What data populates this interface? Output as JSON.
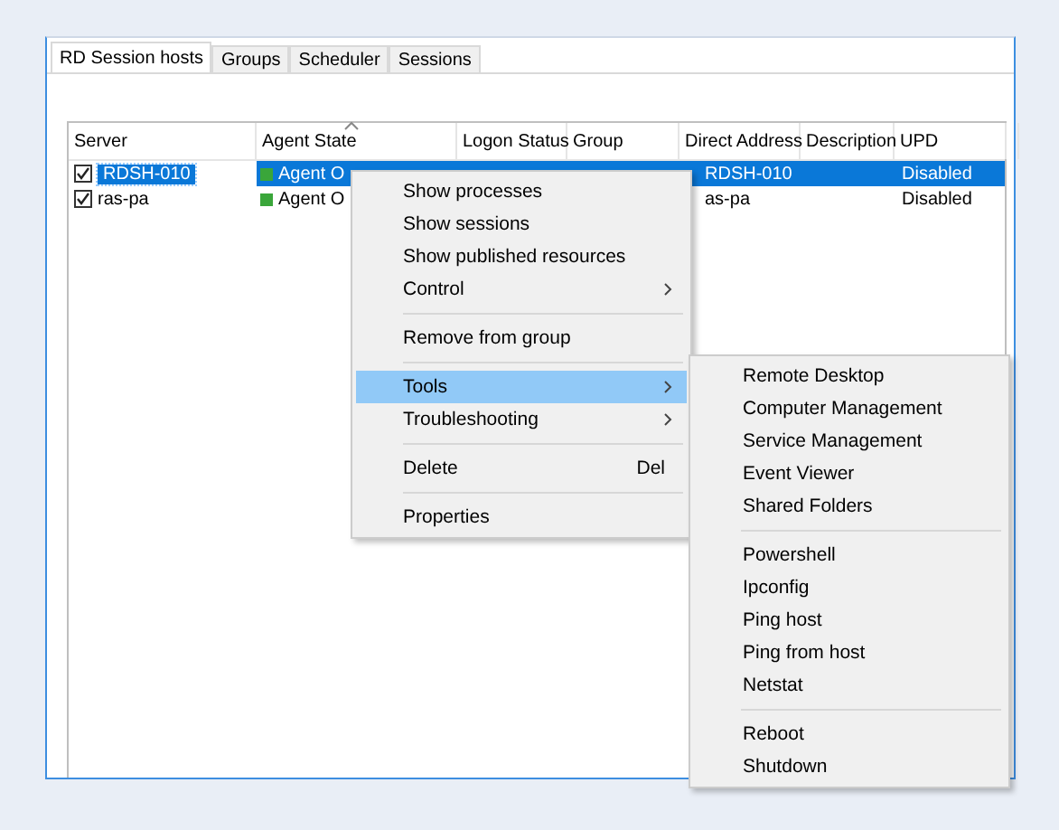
{
  "tabs": [
    {
      "label": "RD Session hosts",
      "selected": true
    },
    {
      "label": "Groups",
      "selected": false
    },
    {
      "label": "Scheduler",
      "selected": false
    },
    {
      "label": "Sessions",
      "selected": false
    }
  ],
  "host_list": {
    "columns": [
      {
        "label": "Server",
        "sorted": false
      },
      {
        "label": "Agent State",
        "sorted": true
      },
      {
        "label": "Logon Status",
        "sorted": false
      },
      {
        "label": "Group",
        "sorted": false
      },
      {
        "label": "Direct Address",
        "sorted": false
      },
      {
        "label": "Description",
        "sorted": false
      },
      {
        "label": "UPD",
        "sorted": false
      }
    ],
    "rows": [
      {
        "checked": true,
        "selected": true,
        "server": "RDSH-010",
        "agent_state": "Agent O",
        "color": "#3aa63a",
        "direct_address": "RDSH-010",
        "upd": "Disabled"
      },
      {
        "checked": true,
        "selected": false,
        "server": "ras-pa",
        "agent_state": "Agent O",
        "color": "#3aa63a",
        "direct_address": "as-pa",
        "upd": "Disabled"
      }
    ]
  },
  "context_menu": [
    {
      "kind": "item",
      "label": "Show processes",
      "submenu": false,
      "selected": false
    },
    {
      "kind": "item",
      "label": "Show sessions",
      "submenu": false,
      "selected": false
    },
    {
      "kind": "item",
      "label": "Show published resources",
      "submenu": false,
      "selected": false
    },
    {
      "kind": "item",
      "label": "Control",
      "submenu": true,
      "selected": false
    },
    {
      "kind": "separator"
    },
    {
      "kind": "item",
      "label": "Remove from group",
      "submenu": false,
      "selected": false
    },
    {
      "kind": "separator"
    },
    {
      "kind": "item",
      "label": "Tools",
      "submenu": true,
      "selected": true
    },
    {
      "kind": "item",
      "label": "Troubleshooting",
      "submenu": true,
      "selected": false
    },
    {
      "kind": "separator"
    },
    {
      "kind": "item",
      "label": "Delete",
      "shortcut": "Del",
      "submenu": false,
      "selected": false
    },
    {
      "kind": "separator"
    },
    {
      "kind": "item",
      "label": "Properties",
      "submenu": false,
      "selected": false
    }
  ],
  "tools_submenu": [
    {
      "kind": "item",
      "label": "Remote Desktop"
    },
    {
      "kind": "item",
      "label": "Computer Management"
    },
    {
      "kind": "item",
      "label": "Service Management"
    },
    {
      "kind": "item",
      "label": "Event Viewer"
    },
    {
      "kind": "item",
      "label": "Shared Folders"
    },
    {
      "kind": "separator"
    },
    {
      "kind": "item",
      "label": "Powershell"
    },
    {
      "kind": "item",
      "label": "Ipconfig"
    },
    {
      "kind": "item",
      "label": "Ping host"
    },
    {
      "kind": "item",
      "label": "Ping from host"
    },
    {
      "kind": "item",
      "label": "Netstat"
    },
    {
      "kind": "separator"
    },
    {
      "kind": "item",
      "label": "Reboot"
    },
    {
      "kind": "item",
      "label": "Shutdown"
    }
  ]
}
